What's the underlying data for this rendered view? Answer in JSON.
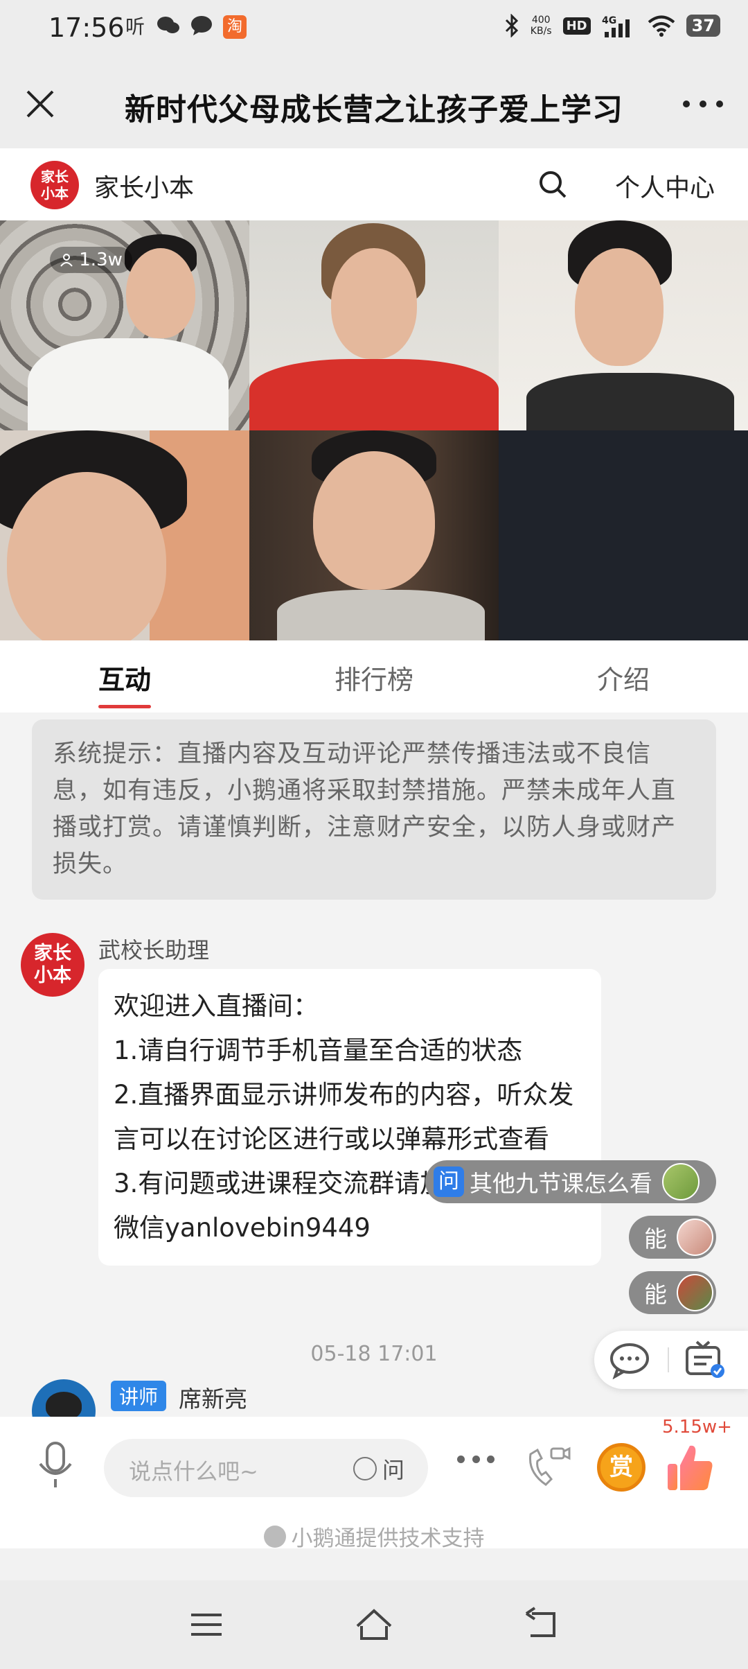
{
  "status_bar": {
    "time": "17:56",
    "app_icons": [
      "听",
      "微信",
      "消息",
      "淘"
    ],
    "network_speed": "400\nKB/s",
    "hd_label": "HD",
    "signal_label": "4G",
    "battery": "37"
  },
  "title_bar": {
    "title": "新时代父母成长营之让孩子爱上学习"
  },
  "brand": {
    "logo_text": "家长\n小本",
    "name": "家长小本",
    "profile_label": "个人中心"
  },
  "video": {
    "viewer_count": "1.3w"
  },
  "tabs": [
    {
      "label": "互动",
      "active": true
    },
    {
      "label": "排行榜",
      "active": false
    },
    {
      "label": "介绍",
      "active": false
    }
  ],
  "chat": {
    "system_notice": "系统提示：直播内容及互动评论严禁传播违法或不良信息，如有违反，小鹅通将采取封禁措施。严禁未成年人直播或打赏。请谨慎判断，注意财产安全，以防人身或财产损失。",
    "message": {
      "avatar_text": "家长\n小本",
      "sender": "武校长助理",
      "lines": [
        "欢迎进入直播间：",
        "1.请自行调节手机音量至合适的状态",
        "2.直播界面显示讲师发布的内容，听众发言可以在讨论区进行或以弹幕形式查看",
        "3.有问题或进课程交流群请加武校长助理微信yanlovebin9449"
      ]
    },
    "timestamp": "05-18 17:01",
    "lecturer": {
      "role": "讲师",
      "name": "席新亮"
    },
    "floating_chips": [
      {
        "badge": "问",
        "text": "其他九节课怎么看"
      },
      {
        "text": "能"
      },
      {
        "text": "能"
      }
    ]
  },
  "input_bar": {
    "placeholder": "说点什么吧~",
    "ask_label": "问",
    "reward_label": "赏",
    "like_count": "5.15w+",
    "support_text": "小鹅通提供技术支持"
  },
  "colors": {
    "brand_red": "#d7262c",
    "tab_indicator": "#e03a3a",
    "question_blue": "#2f7de8",
    "reward_orange": "#f6a31a"
  }
}
